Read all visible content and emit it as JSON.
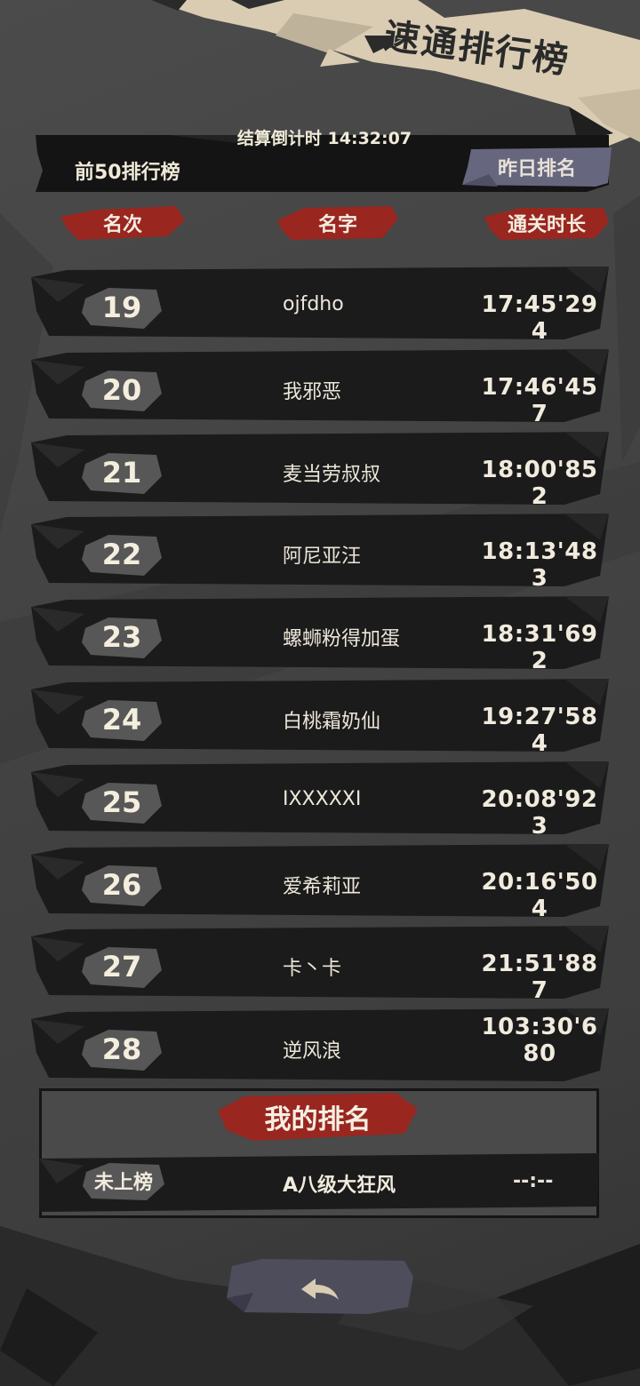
{
  "header": {
    "title": "速通排行榜",
    "countdown_label": "结算倒计时",
    "countdown_value": "14:32:07"
  },
  "tabs": {
    "top_label": "前50排行榜",
    "yesterday_label": "昨日排名"
  },
  "columns": {
    "rank": "名次",
    "name": "名字",
    "time": "通关时长"
  },
  "rows": [
    {
      "rank": "19",
      "name": "ojfdho",
      "time": "17:45'294"
    },
    {
      "rank": "20",
      "name": "我邪恶",
      "time": "17:46'457"
    },
    {
      "rank": "21",
      "name": "麦当劳叔叔",
      "time": "18:00'852"
    },
    {
      "rank": "22",
      "name": "阿尼亚汪",
      "time": "18:13'483"
    },
    {
      "rank": "23",
      "name": "螺蛳粉得加蛋",
      "time": "18:31'692"
    },
    {
      "rank": "24",
      "name": "白桃霜奶仙",
      "time": "19:27'584"
    },
    {
      "rank": "25",
      "name": "IXXXXXI",
      "time": "20:08'923"
    },
    {
      "rank": "26",
      "name": "爱希莉亚",
      "time": "20:16'504"
    },
    {
      "rank": "27",
      "name": "卡丶卡",
      "time": "21:51'887"
    },
    {
      "rank": "28",
      "name": "逆风浪",
      "time": "103:30'680"
    }
  ],
  "my_rank": {
    "title": "我的排名",
    "rank": "未上榜",
    "name": "A八级大狂风",
    "time": "--:--"
  },
  "icons": {
    "back": "back-arrow-icon"
  },
  "colors": {
    "accent_red": "#b02a22",
    "tab_purple": "#6a6a86",
    "banner_cream": "#d9ccb2"
  }
}
